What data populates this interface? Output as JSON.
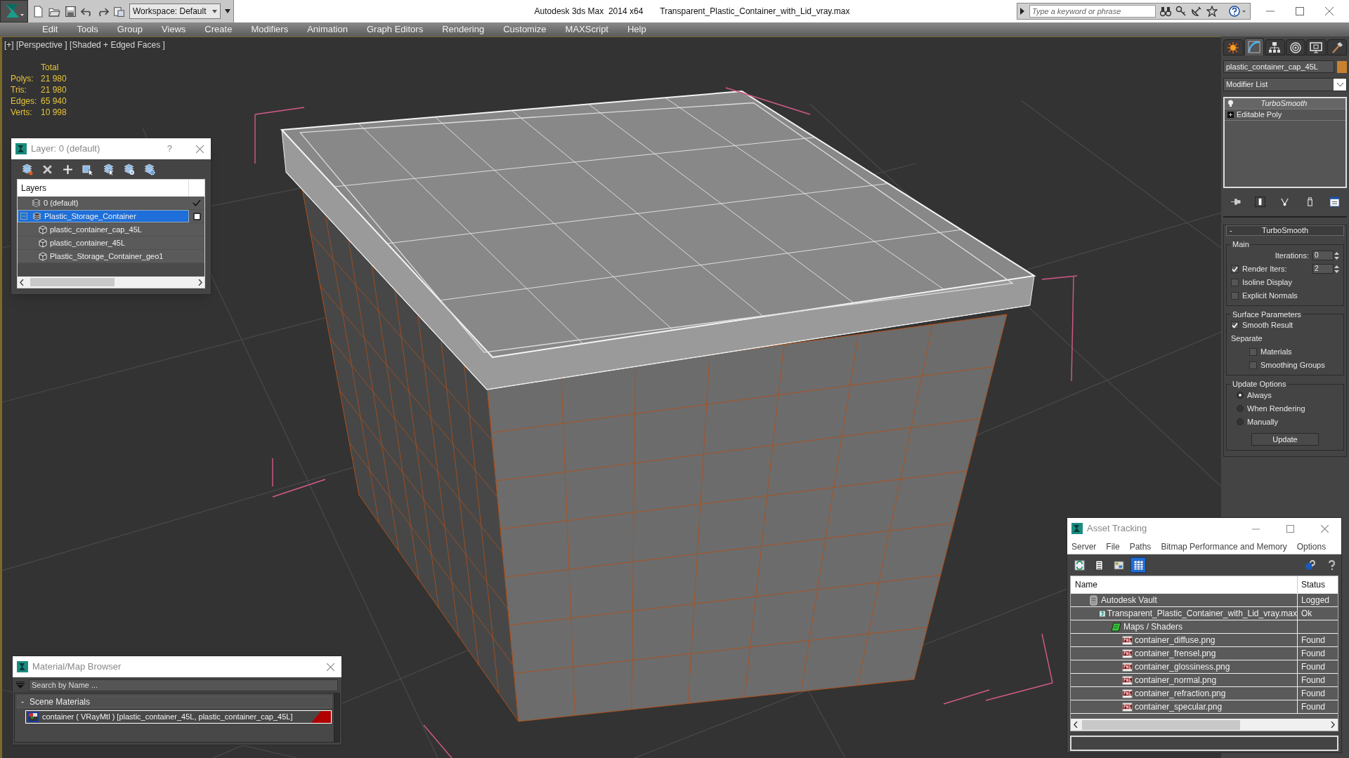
{
  "title_bar": {
    "workspace": "Workspace: Default",
    "app_title": "Autodesk 3ds Max  2014 x64",
    "file_name": "Transparent_Plastic_Container_with_Lid_vray.max",
    "search": {
      "placeholder": "Type a keyword or phrase"
    }
  },
  "menu_bar": [
    "Edit",
    "Tools",
    "Group",
    "Views",
    "Create",
    "Modifiers",
    "Animation",
    "Graph Editors",
    "Rendering",
    "Customize",
    "MAXScript",
    "Help"
  ],
  "viewport": {
    "label": "[+] [Perspective ] [Shaded + Edged Faces ]",
    "stats": {
      "heading": "Total",
      "rows": [
        {
          "label": "Polys:",
          "value": "21 980"
        },
        {
          "label": "Tris:",
          "value": "21 980"
        },
        {
          "label": "Edges:",
          "value": "65 940"
        },
        {
          "label": "Verts:",
          "value": "10 998"
        }
      ]
    }
  },
  "layer_window": {
    "title": "Layer: 0 (default)",
    "help": "?",
    "column": "Layers",
    "layers": [
      {
        "name": "0 (default)",
        "selected": false,
        "current": true
      },
      {
        "name": "Plastic_Storage_Container",
        "selected": true,
        "current": false,
        "expanded": true,
        "children": [
          {
            "name": "plastic_container_cap_45L"
          },
          {
            "name": "plastic_container_45L"
          },
          {
            "name": "Plastic_Storage_Container_geo1"
          }
        ]
      }
    ]
  },
  "command_panel": {
    "tabs": [
      {
        "kind": "create",
        "selected": false
      },
      {
        "kind": "modify",
        "selected": true
      },
      {
        "kind": "hierarchy",
        "selected": false
      },
      {
        "kind": "motion",
        "selected": false
      },
      {
        "kind": "display",
        "selected": false
      },
      {
        "kind": "utilities",
        "selected": false
      }
    ],
    "object": {
      "name": "plastic_container_cap_45L",
      "color": "#c8822e"
    },
    "modifier_list": "Modifier List",
    "stack": [
      {
        "kind": "modifier",
        "name": "TurboSmooth"
      },
      {
        "kind": "base",
        "name": "Editable Poly"
      }
    ],
    "rollout": {
      "title": "TurboSmooth",
      "toggle": "-",
      "groups": [
        {
          "title": "Main",
          "items": [
            {
              "kind": "spinner",
              "label": "Iterations:",
              "value": "0"
            },
            {
              "kind": "check_spinner",
              "label": "Render Iters:",
              "value": "2",
              "checked": true
            },
            {
              "kind": "checkbox",
              "label": "Isoline Display",
              "checked": false
            },
            {
              "kind": "checkbox",
              "label": "Explicit Normals",
              "checked": false
            }
          ]
        },
        {
          "title": "Surface Parameters",
          "items": [
            {
              "kind": "checkbox",
              "label": "Smooth Result",
              "checked": true
            },
            {
              "kind": "label",
              "label": "Separate"
            },
            {
              "kind": "subcheckbox",
              "label": "Materials",
              "checked": false
            },
            {
              "kind": "subcheckbox",
              "label": "Smoothing Groups",
              "checked": false
            }
          ]
        },
        {
          "title": "Update Options",
          "items": [
            {
              "kind": "radio",
              "label": "Always",
              "selected": true
            },
            {
              "kind": "radio",
              "label": "When Rendering",
              "selected": false
            },
            {
              "kind": "radio",
              "label": "Manually",
              "selected": false
            },
            {
              "kind": "button",
              "label": "Update"
            }
          ]
        }
      ]
    }
  },
  "asset_window": {
    "title": "Asset Tracking",
    "menus": [
      "Server",
      "File",
      "Paths",
      "Bitmap Performance and Memory",
      "Options"
    ],
    "tools": [
      {
        "kind": "refresh",
        "selected": false
      },
      {
        "kind": "list",
        "selected": false
      },
      {
        "kind": "thumbnails",
        "selected": false
      },
      {
        "kind": "table",
        "selected": true
      }
    ],
    "columns": [
      "Name",
      "Status"
    ],
    "rows": [
      {
        "kind": "vault",
        "name": "Autodesk Vault",
        "status": "Logged",
        "children": [
          {
            "kind": "max",
            "name": "Transparent_Plastic_Container_with_Lid_vray.max",
            "status": "Ok",
            "children": [
              {
                "kind": "folder",
                "name": "Maps / Shaders",
                "children": [
                  {
                    "kind": "png",
                    "name": "container_diffuse.png",
                    "status": "Found"
                  },
                  {
                    "kind": "png",
                    "name": "container_frensel.png",
                    "status": "Found"
                  },
                  {
                    "kind": "png",
                    "name": "container_glossiness.png",
                    "status": "Found"
                  },
                  {
                    "kind": "png",
                    "name": "container_normal.png",
                    "status": "Found"
                  },
                  {
                    "kind": "png",
                    "name": "container_refraction.png",
                    "status": "Found"
                  },
                  {
                    "kind": "png",
                    "name": "container_specular.png",
                    "status": "Found"
                  }
                ]
              }
            ]
          }
        ]
      }
    ]
  },
  "material_browser": {
    "title": "Material/Map Browser",
    "search": {
      "placeholder": "Search by Name ..."
    },
    "group": {
      "toggle": "-",
      "title": "Scene Materials",
      "items": [
        {
          "name": "container ( VRayMtl ) [plastic_container_45L, plastic_container_cap_45L]",
          "selected": true
        }
      ]
    }
  }
}
